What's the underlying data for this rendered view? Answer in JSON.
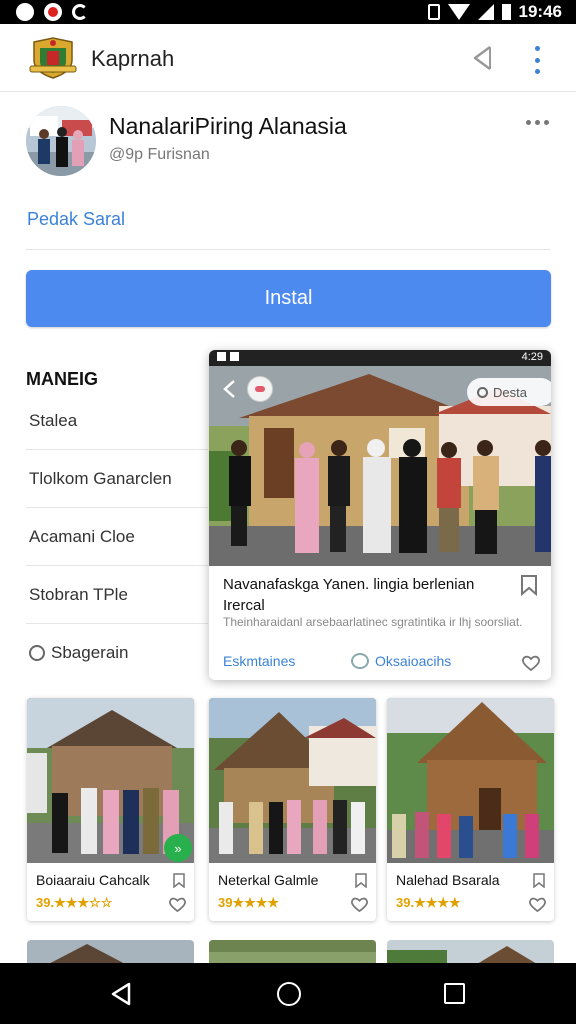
{
  "status_bar": {
    "time": "19:46"
  },
  "app_bar": {
    "title": "Kaprnah"
  },
  "profile": {
    "name": "NanalariPiring Alanasia",
    "handle": "@9p Furisnan"
  },
  "link": "Pedak Saral",
  "install_label": "Instal",
  "menu": {
    "title": "MANEIG",
    "items": [
      "Stalea",
      "Tlolkom Ganarclen",
      "Acamani Cloe",
      "Stobran TPle",
      "Sbagerain"
    ]
  },
  "overlay": {
    "status_time": "4:29",
    "search_placeholder": "Desta",
    "title": "Navanafaskga Yanen. lingia berlenian Irercal",
    "description": "Theinharaidanl arsebaarlatinec sgratintika ir lhj soorsliat.",
    "link_left": "Eskmtaines",
    "link_right": "Oksaioacihs"
  },
  "cards": [
    {
      "title": "Boiaaraiu Cahcalk",
      "rating": "39.★★★☆☆",
      "fab": "»"
    },
    {
      "title": "Neterkal Galmle",
      "rating": "39★★★★"
    },
    {
      "title": "Nalehad Bsarala",
      "rating": "39.★★★★"
    }
  ],
  "colors": {
    "accent": "#3b82d6",
    "button": "#4d8af0",
    "star": "#e0a100",
    "fab": "#27b04b"
  },
  "icons": {
    "share": "share-icon",
    "more": "more-vertical-icon",
    "back": "back-arrow-icon",
    "bookmark": "bookmark-icon",
    "heart": "heart-icon",
    "search": "search-icon"
  }
}
